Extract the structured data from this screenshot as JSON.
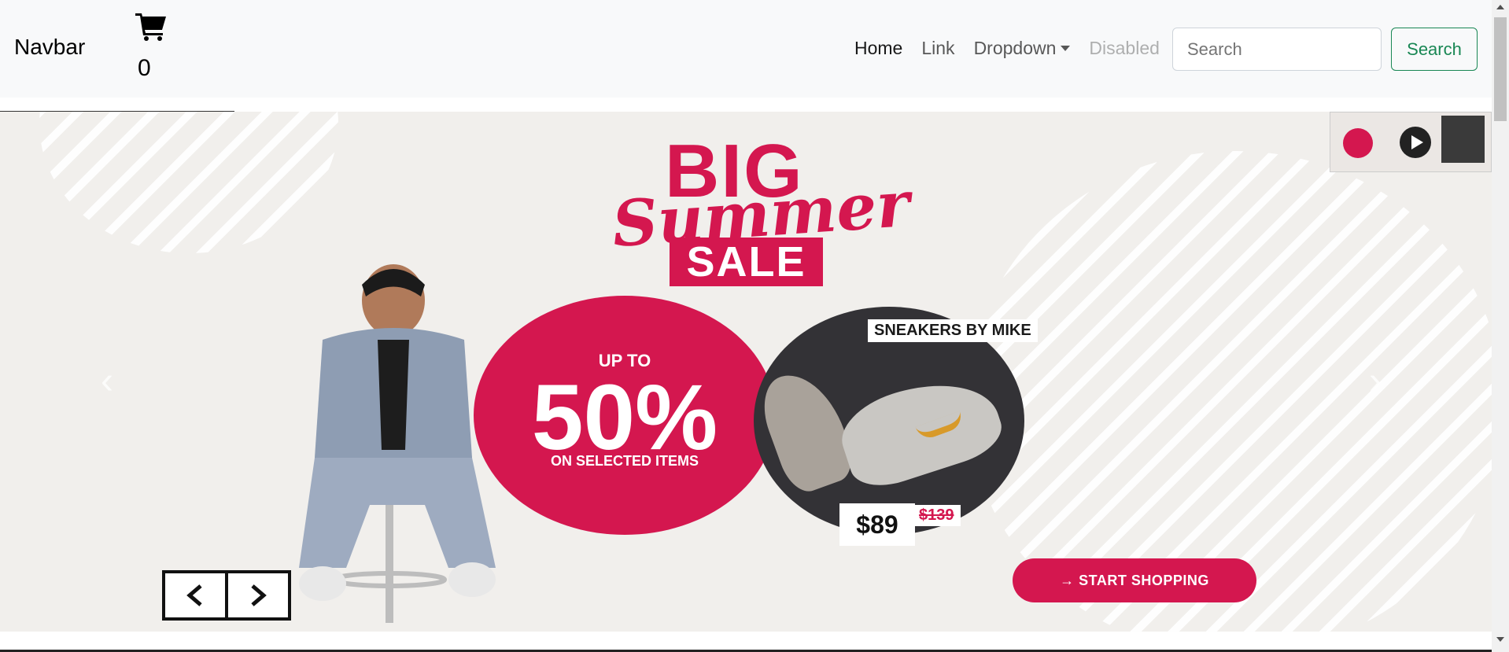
{
  "navbar": {
    "brand": "Navbar",
    "cart_count": "0",
    "links": [
      {
        "label": "Home"
      },
      {
        "label": "Link"
      },
      {
        "label": "Dropdown"
      },
      {
        "label": "Disabled"
      }
    ],
    "search": {
      "placeholder": "Search",
      "button_label": "Search"
    }
  },
  "banner": {
    "big": "BIG",
    "summer": "Summer",
    "sale": "SALE",
    "up_to": "UP TO",
    "percent": "50%",
    "on_selected": "ON SELECTED ITEMS",
    "product_label": "SNEAKERS BY MIKE",
    "price": "$89",
    "old_price": "$139",
    "cta": "→ START SHOPPING",
    "prev_glyph": "‹",
    "next_glyph": "›"
  },
  "colors": {
    "accent": "#d4174f",
    "success": "#198754",
    "navbar_bg": "#f8f9fa"
  },
  "icons": [
    "cart-icon",
    "chevron-left-icon",
    "chevron-right-icon",
    "play-icon"
  ]
}
